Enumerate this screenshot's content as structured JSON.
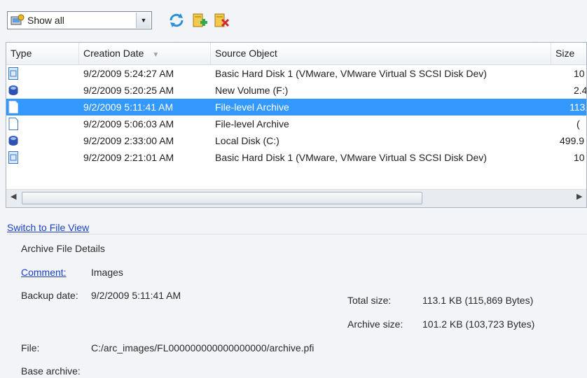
{
  "toolbar": {
    "filter_value": "Show all",
    "icons": [
      "show-all-filter-icon",
      "refresh-icon",
      "add-archive-icon",
      "delete-archive-icon"
    ]
  },
  "grid": {
    "columns": [
      "Type",
      "Creation Date",
      "Source Object",
      "Size"
    ],
    "rows": [
      {
        "type_icon": "disk-image-icon",
        "date": "9/2/2009 5:24:27 AM",
        "source": "Basic Hard Disk 1 (VMware, VMware Virtual S SCSI Disk Dev)",
        "size": "10"
      },
      {
        "type_icon": "partition-icon",
        "date": "9/2/2009 5:20:25 AM",
        "source": "New Volume (F:)",
        "size": "2.4"
      },
      {
        "type_icon": "file-archive-icon",
        "date": "9/2/2009 5:11:41 AM",
        "source": "File-level Archive",
        "size": "113.",
        "selected": true
      },
      {
        "type_icon": "file-archive-icon",
        "date": "9/2/2009 5:06:03 AM",
        "source": "File-level Archive",
        "size": "("
      },
      {
        "type_icon": "partition-icon",
        "date": "9/2/2009 2:33:00 AM",
        "source": "Local Disk (C:)",
        "size": "499.9"
      },
      {
        "type_icon": "disk-image-icon",
        "date": "9/2/2009 2:21:01 AM",
        "source": "Basic Hard Disk 1 (VMware, VMware Virtual S SCSI Disk Dev)",
        "size": "10"
      }
    ]
  },
  "switch_link": "Switch to File View",
  "details": {
    "section_title": "Archive File Details",
    "comment_label": "Comment:",
    "comment_value": "Images",
    "backup_date_label": "Backup date:",
    "backup_date_value": "9/2/2009 5:11:41 AM",
    "total_size_label": "Total size:",
    "total_size_value": "113.1 KB (115,869 Bytes)",
    "archive_size_label": "Archive size:",
    "archive_size_value": "101.2 KB (103,723 Bytes)",
    "file_label": "File:",
    "file_value": "C:/arc_images/FL000000000000000000/archive.pfi",
    "base_archive_label": "Base archive:"
  },
  "colors": {
    "selection": "#3399ff",
    "link": "#1a3fbf",
    "background": "#f2f4f7"
  }
}
